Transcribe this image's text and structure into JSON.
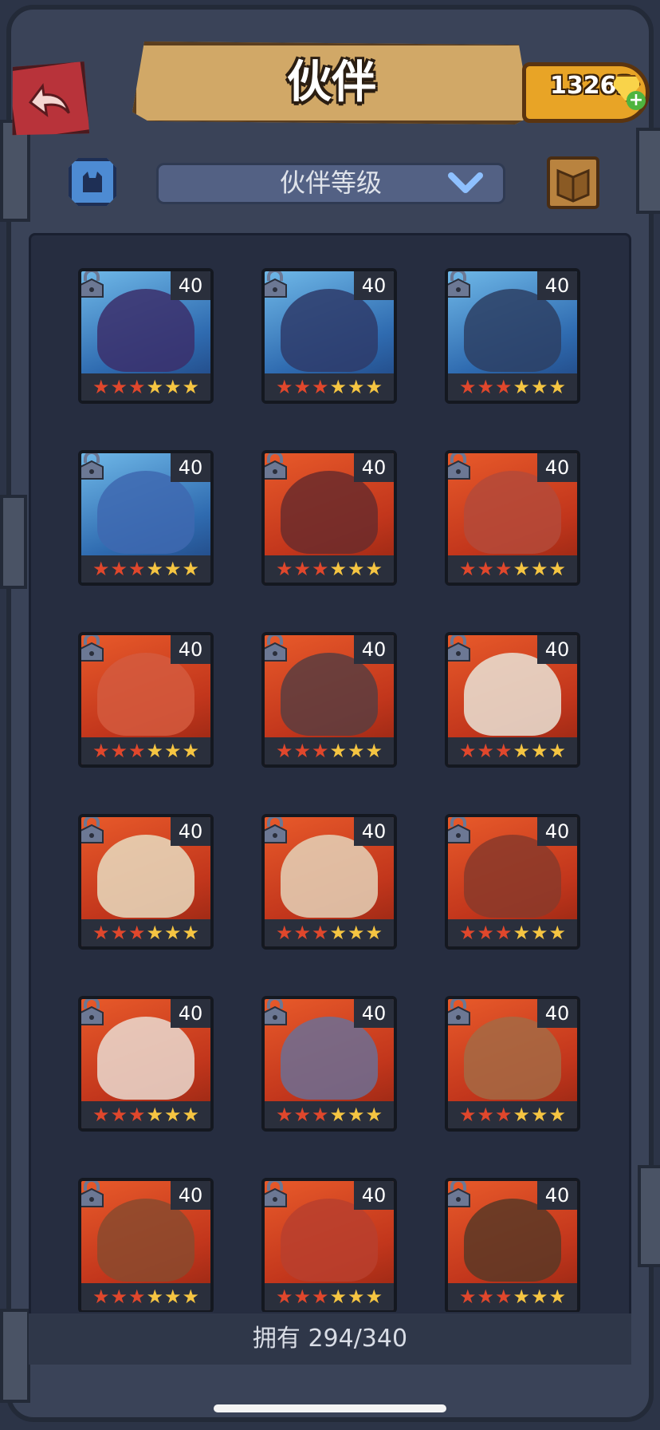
{
  "header": {
    "title": "伙伴",
    "gems": "13263"
  },
  "filter": {
    "selected": "伙伴等级"
  },
  "partners": [
    {
      "level": "40",
      "stars_red": 3,
      "stars_gold": 3,
      "theme": "blue",
      "portrait": "#3b2f6b"
    },
    {
      "level": "40",
      "stars_red": 3,
      "stars_gold": 3,
      "theme": "blue",
      "portrait": "#2e3b6a"
    },
    {
      "level": "40",
      "stars_red": 3,
      "stars_gold": 3,
      "theme": "blue",
      "portrait": "#2d3f64"
    },
    {
      "level": "40",
      "stars_red": 3,
      "stars_gold": 3,
      "theme": "blue",
      "portrait": "#3e69b0"
    },
    {
      "level": "40",
      "stars_red": 3,
      "stars_gold": 3,
      "theme": "red",
      "portrait": "#6b2b2b"
    },
    {
      "level": "40",
      "stars_red": 3,
      "stars_gold": 3,
      "theme": "red",
      "portrait": "#b44a3a"
    },
    {
      "level": "40",
      "stars_red": 3,
      "stars_gold": 3,
      "theme": "red",
      "portrait": "#d35a3e"
    },
    {
      "level": "40",
      "stars_red": 3,
      "stars_gold": 3,
      "theme": "red",
      "portrait": "#5a3d40"
    },
    {
      "level": "40",
      "stars_red": 3,
      "stars_gold": 3,
      "theme": "red",
      "portrait": "#e9e3d6"
    },
    {
      "level": "40",
      "stars_red": 3,
      "stars_gold": 3,
      "theme": "red",
      "portrait": "#e7dcc0"
    },
    {
      "level": "40",
      "stars_red": 3,
      "stars_gold": 3,
      "theme": "red",
      "portrait": "#e4d2b8"
    },
    {
      "level": "40",
      "stars_red": 3,
      "stars_gold": 3,
      "theme": "red",
      "portrait": "#8a3a2a"
    },
    {
      "level": "40",
      "stars_red": 3,
      "stars_gold": 3,
      "theme": "red",
      "portrait": "#eadbd0"
    },
    {
      "level": "40",
      "stars_red": 3,
      "stars_gold": 3,
      "theme": "red",
      "portrait": "#6c6f94"
    },
    {
      "level": "40",
      "stars_red": 3,
      "stars_gold": 3,
      "theme": "red",
      "portrait": "#a56a44"
    },
    {
      "level": "40",
      "stars_red": 3,
      "stars_gold": 3,
      "theme": "red",
      "portrait": "#8a4a2e"
    },
    {
      "level": "40",
      "stars_red": 3,
      "stars_gold": 3,
      "theme": "red",
      "portrait": "#b8402e"
    },
    {
      "level": "40",
      "stars_red": 3,
      "stars_gold": 3,
      "theme": "red",
      "portrait": "#5a3826"
    }
  ],
  "footer": {
    "owned": "拥有 294/340"
  },
  "icons": {
    "back": "back-arrow-icon",
    "filter": "cat-filter-icon",
    "dropdown": "chevron-down-icon",
    "book": "book-icon",
    "lock": "lock-icon",
    "gem": "gem-icon",
    "plus": "plus-icon"
  }
}
